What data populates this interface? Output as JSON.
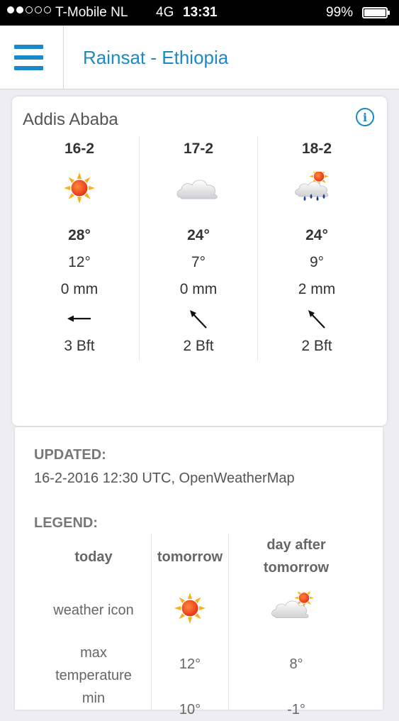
{
  "status_bar": {
    "carrier": "T-Mobile NL",
    "network": "4G",
    "time": "13:31",
    "battery": "99%",
    "battery_level": 0.99
  },
  "header": {
    "title": "Rainsat - Ethiopia",
    "menu_icon": "hamburger-menu-icon"
  },
  "forecast": {
    "city": "Addis Ababa",
    "info_icon_glyph": "i",
    "days": [
      {
        "date": "16-2",
        "icon": "sunny-icon",
        "max": "28°",
        "min": "12°",
        "rain": "0 mm",
        "wind_dir": "west",
        "wind": "3 Bft"
      },
      {
        "date": "17-2",
        "icon": "cloudy-icon",
        "max": "24°",
        "min": "7°",
        "rain": "0 mm",
        "wind_dir": "northwest",
        "wind": "2 Bft"
      },
      {
        "date": "18-2",
        "icon": "rain-sun-icon",
        "max": "24°",
        "min": "9°",
        "rain": "2 mm",
        "wind_dir": "northwest",
        "wind": "2 Bft"
      }
    ]
  },
  "info": {
    "updated_heading": "UPDATED:",
    "updated_value": "16-2-2016 12:30 UTC, OpenWeatherMap",
    "legend_heading": "LEGEND:",
    "legend": {
      "col1": {
        "heading": "today",
        "row1": "weather icon",
        "row2a": "max",
        "row2b": "temperature",
        "row3": "min"
      },
      "col2": {
        "heading": "tomorrow",
        "icon": "sunny-icon",
        "row2": "12°",
        "row3": "10°"
      },
      "col3": {
        "heading_a": "day after",
        "heading_b": "tomorrow",
        "icon": "cloud-sun-icon",
        "row2": "8°",
        "row3": "-1°"
      }
    }
  },
  "colors": {
    "accent": "#1a8ac6",
    "sun": "#f04a1a",
    "rain_drop": "#1e3f99"
  }
}
